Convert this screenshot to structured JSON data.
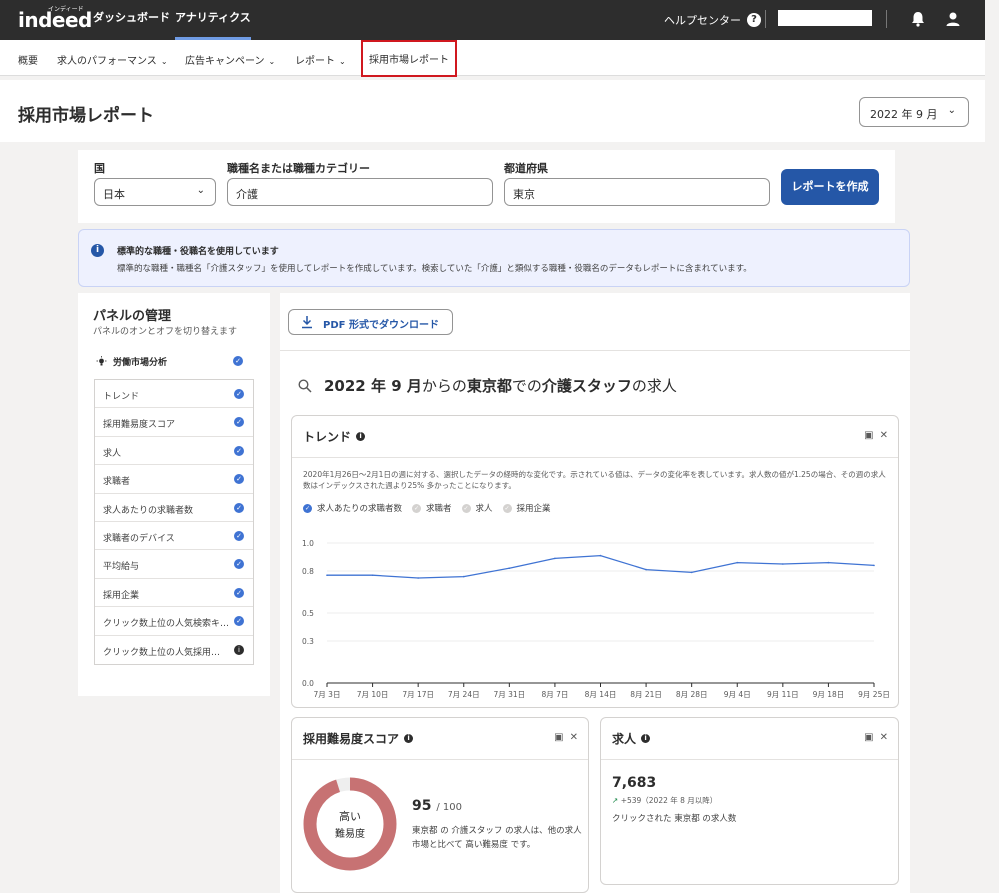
{
  "topbar": {
    "logo": "indeed",
    "logo_sub": "インディード",
    "nav": [
      "ダッシュボード",
      "アナリティクス"
    ],
    "help": "ヘルプセンター"
  },
  "subnav": {
    "items": [
      "概要",
      "求人のパフォーマンス",
      "広告キャンペーン",
      "レポート",
      "採用市場レポート"
    ]
  },
  "page": {
    "title": "採用市場レポート",
    "date_value": "2022 年 9 月"
  },
  "form": {
    "country_label": "国",
    "country_value": "日本",
    "job_label": "職種名または職種カテゴリー",
    "job_value": "介護",
    "pref_label": "都道府県",
    "pref_value": "東京",
    "create_button": "レポートを作成"
  },
  "banner": {
    "title": "標準的な職種・役職名を使用しています",
    "text": "標準的な職種・職種名「介護スタッフ」を使用してレポートを作成しています。検索していた「介護」と類似する職種・役職名のデータもレポートに含まれています。"
  },
  "panel": {
    "title": "パネルの管理",
    "subtitle": "パネルのオンとオフを切り替えます",
    "group": "労働市場分析",
    "items": [
      {
        "label": "トレンド",
        "on": true
      },
      {
        "label": "採用難易度スコア",
        "on": true
      },
      {
        "label": "求人",
        "on": true
      },
      {
        "label": "求職者",
        "on": true
      },
      {
        "label": "求人あたりの求職者数",
        "on": true
      },
      {
        "label": "求職者のデバイス",
        "on": true
      },
      {
        "label": "平均給与",
        "on": true
      },
      {
        "label": "採用企業",
        "on": true
      },
      {
        "label": "クリック数上位の人気検索キ…",
        "on": true
      },
      {
        "label": "クリック数上位の人気採用…",
        "on": false
      }
    ]
  },
  "main": {
    "pdf_button": "PDF 形式でダウンロード",
    "heading": {
      "date": "2022 年 9 月",
      "from": "からの",
      "place": "東京都",
      "in": "での",
      "job": "介護スタッフ",
      "suffix": "の求人"
    }
  },
  "trend": {
    "title": "トレンド",
    "description": "2020年1月26日〜2月1日の週に対する、選択したデータの経時的な変化です。示されている値は、データの変化率を表しています。求人数の値が1.25の場合、その週の求人数はインデックスされた週より25% 多かったことになります。",
    "legend": [
      {
        "label": "求人あたりの求職者数",
        "active": true
      },
      {
        "label": "求職者",
        "active": false
      },
      {
        "label": "求人",
        "active": false
      },
      {
        "label": "採用企業",
        "active": false
      }
    ]
  },
  "chart_data": {
    "type": "line",
    "x": [
      "7月 3日",
      "7月 10日",
      "7月 17日",
      "7月 24日",
      "7月 31日",
      "8月 7日",
      "8月 14日",
      "8月 21日",
      "8月 28日",
      "9月 4日",
      "9月 11日",
      "9月 18日",
      "9月 25日"
    ],
    "series": [
      {
        "name": "求人あたりの求職者数",
        "values": [
          0.77,
          0.77,
          0.75,
          0.76,
          0.82,
          0.89,
          0.91,
          0.81,
          0.79,
          0.86,
          0.85,
          0.86,
          0.84
        ]
      }
    ],
    "yticks": [
      "0.0",
      "0.3",
      "0.5",
      "0.8",
      "1.0"
    ],
    "ylim": [
      0,
      1.0
    ],
    "color": "#3f73d3"
  },
  "difficulty": {
    "title": "採用難易度スコア",
    "gauge_label_1": "高い",
    "gauge_label_2": "難易度",
    "score": "95",
    "score_max": "/ 100",
    "score_fraction": 0.95,
    "desc": "東京都 の 介護スタッフ の求人は、他の求人市場と比べて 高い難易度 です。",
    "gauge_color": "#c77273"
  },
  "jobs": {
    "title": "求人",
    "count": "7,683",
    "change": "+539（2022 年 8 月以降）",
    "desc": "クリックされた 東京都 の求人数"
  }
}
